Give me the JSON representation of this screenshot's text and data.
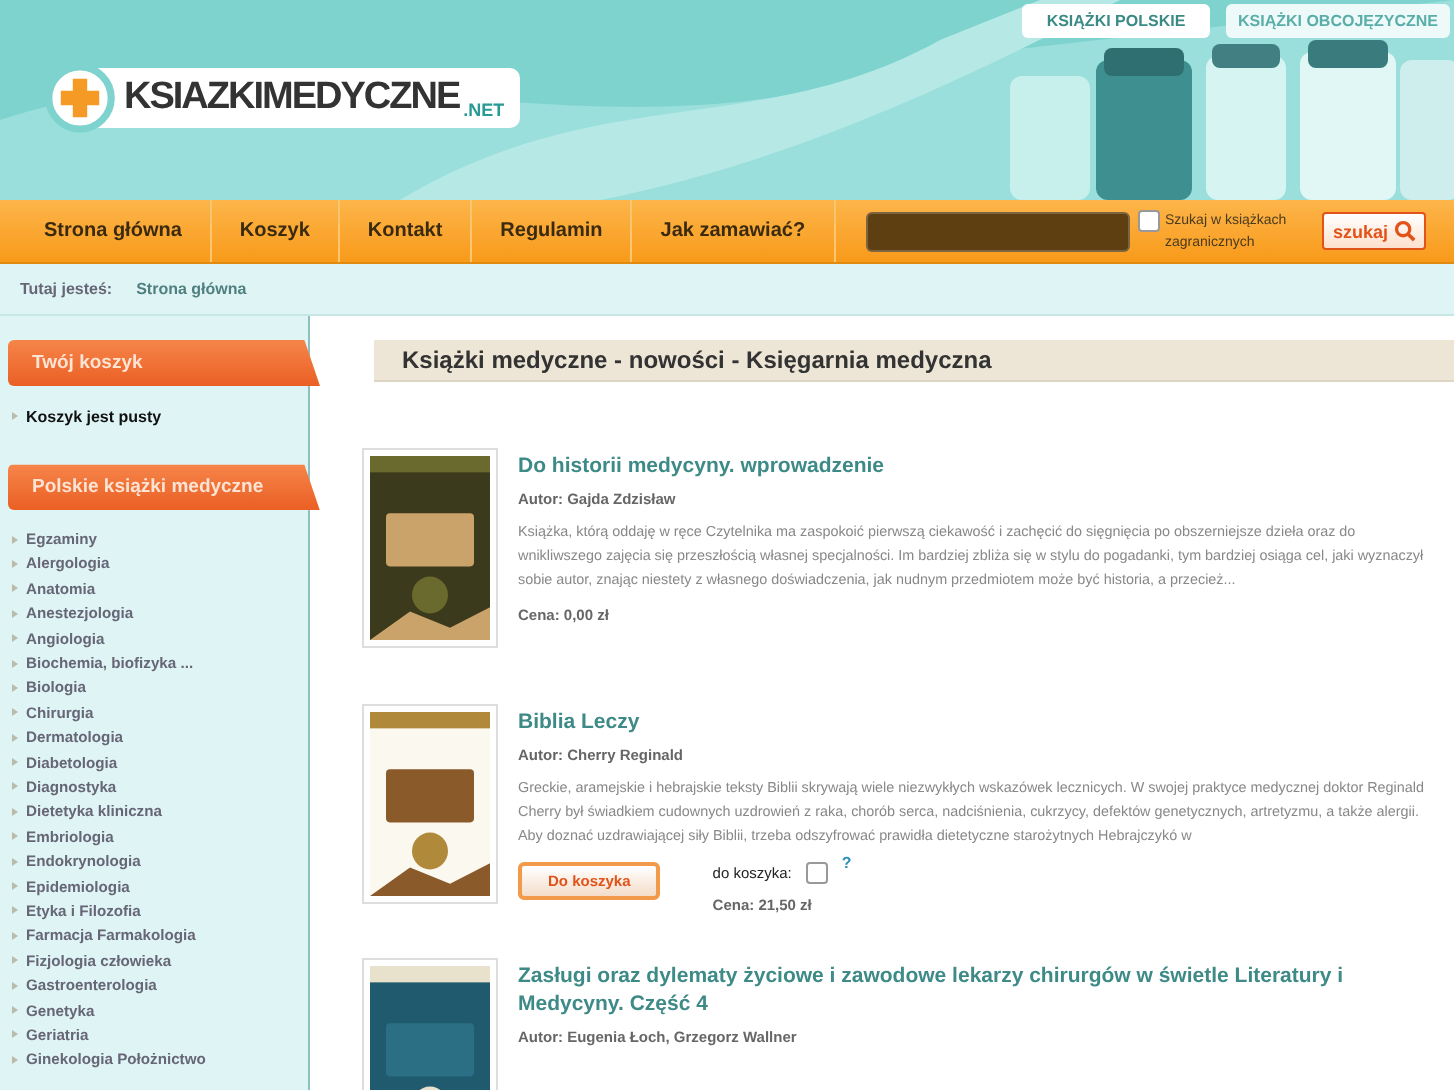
{
  "header": {
    "logo": {
      "name": "KSIAZKIMEDYCZNE",
      "suffix": ".NET"
    },
    "tabs": [
      {
        "label": "KSIĄŻKI POLSKIE",
        "selected": true
      },
      {
        "label": "KSIĄŻKI OBCOJĘZYCZNE",
        "selected": false
      }
    ]
  },
  "nav": {
    "items": [
      "Strona główna",
      "Koszyk",
      "Kontakt",
      "Regulamin",
      "Jak zamawiać?"
    ],
    "search": {
      "foreign_checkbox": {
        "label": "Szukaj w książkach zagranicznych",
        "checked": false
      },
      "button": "szukaj"
    }
  },
  "breadcrumb": {
    "label": "Tutaj jesteś:",
    "items": [
      "Strona główna"
    ]
  },
  "sidebar": {
    "sections": [
      {
        "title": "Twój koszyk",
        "kind": "cart",
        "items": [
          "Koszyk jest pusty"
        ]
      },
      {
        "title": "Polskie książki medyczne",
        "kind": "categories",
        "items": [
          "Egzaminy",
          "Alergologia",
          "Anatomia",
          "Anestezjologia",
          "Angiologia",
          "Biochemia, biofizyka ...",
          "Biologia",
          "Chirurgia",
          "Dermatologia",
          "Diabetologia",
          "Diagnostyka",
          "Dietetyka kliniczna",
          "Embriologia",
          "Endokrynologia",
          "Epidemiologia",
          "Etyka i Filozofia",
          "Farmacja Farmakologia",
          "Fizjologia człowieka",
          "Gastroenterologia",
          "Genetyka",
          "Geriatria",
          "Ginekologia Położnictwo"
        ]
      }
    ]
  },
  "main": {
    "title": "Książki medyczne - nowości - Księgarnia medyczna",
    "books": [
      {
        "title": "Do historii medycyny. wprowadzenie",
        "author": "Autor: Gajda Zdzisław",
        "description": "Książka, którą oddaję w ręce Czytelnika ma zaspokoić pierwszą ciekawość i zachęcić do sięgnięcia po obszerniejsze dzieła oraz do wnikliwszego zajęcia się przeszłością własnej specjalności. Im bardziej zbliża się w stylu do pogadanki, tym bardziej osiąga cel, jaki wyznaczył sobie autor, znając niestety z własnego doświadczenia, jak nudnym przedmiotem może być historia, a przecież...",
        "price": "Cena: 0,00 zł"
      },
      {
        "title": "Biblia Leczy",
        "author": "Autor: Cherry Reginald",
        "description": "Greckie, aramejskie i hebrajskie teksty Biblii skrywają wiele niezwykłych wskazówek lecznicych. W swojej praktyce medycznej doktor Reginald Cherry był świadkiem cudownych uzdrowień z raka, chorób serca, nadciśnienia, cukrzycy, defektów genetycznych, artretyzmu, a także alergii. Aby doznać uzdrawiającej siły Biblii, trzeba odszyfrować prawidła dietetyczne starożytnych Hebrajczykó w",
        "cart": {
          "button": "Do koszyka",
          "label": "do koszyka:",
          "checked": false,
          "help": "?"
        },
        "price": "Cena: 21,50 zł"
      },
      {
        "title": "Zasługi oraz dylematy życiowe i zawodowe lekarzy chirurgów w świetle Literatury i Medycyny. Część 4",
        "author": "Autor: Eugenia Łoch, Grzegorz Wallner"
      }
    ]
  }
}
